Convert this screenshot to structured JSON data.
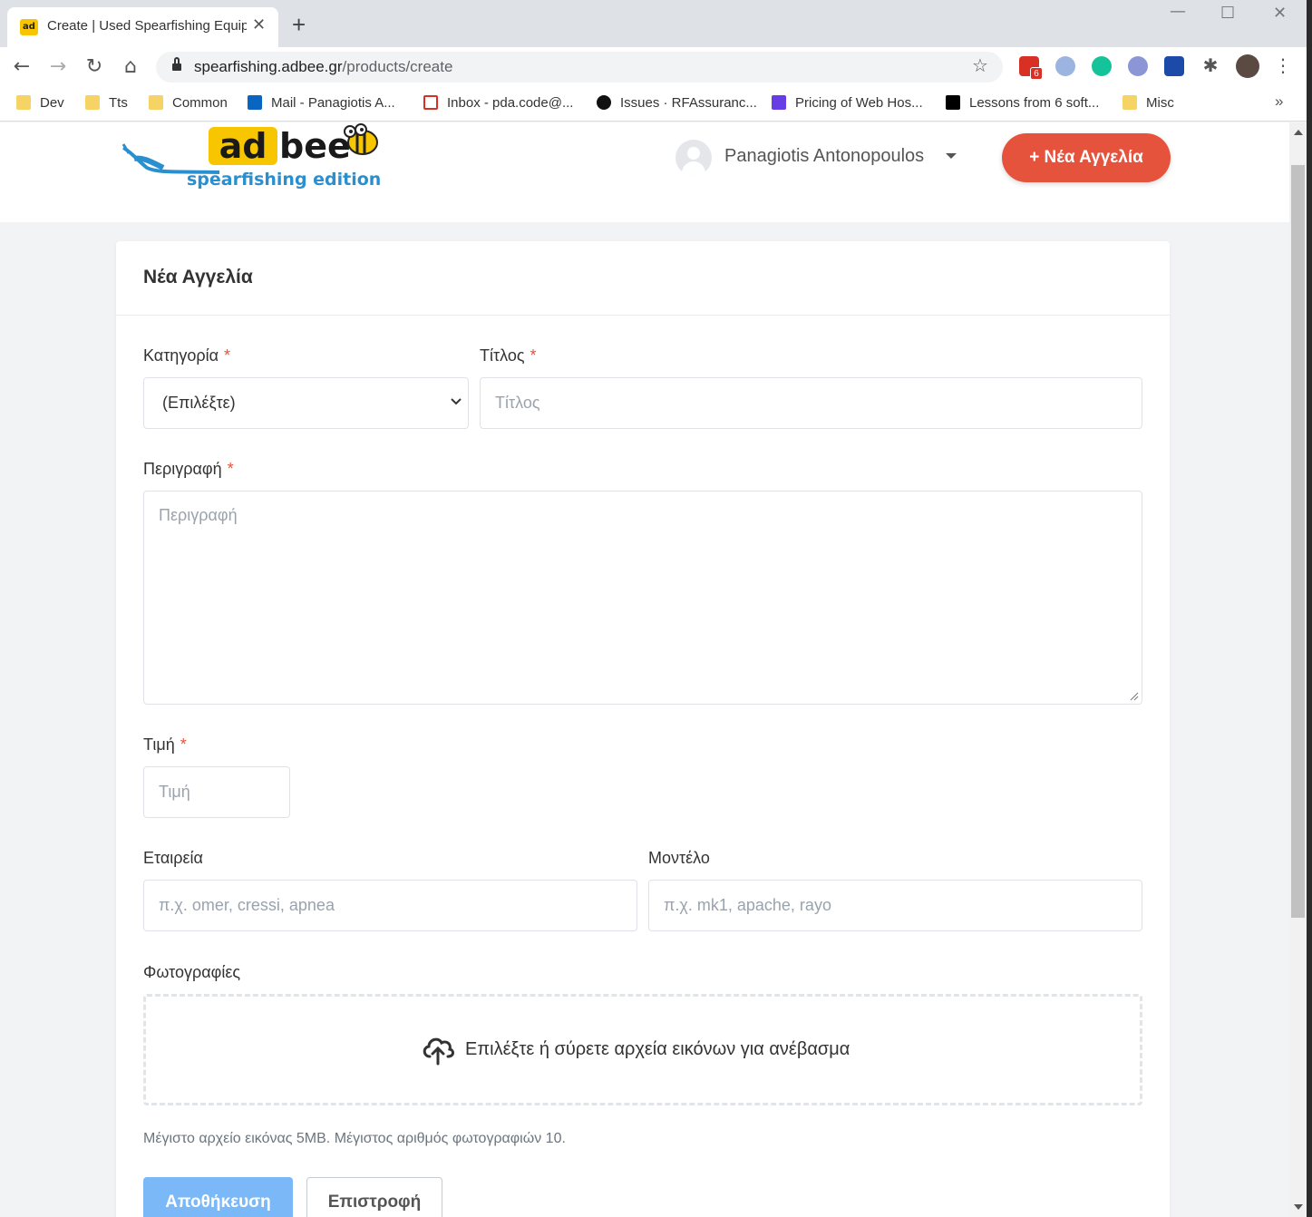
{
  "browser": {
    "tab_title": "Create | Used Spearfishing Equipment",
    "tab_favicon_text": "ad",
    "url_host": "spearfishing.adbee.gr",
    "url_path": "/products/create",
    "gmail_badge": "6",
    "bookmarks": [
      {
        "label": "Dev",
        "icon": "folder-icon"
      },
      {
        "label": "Tts",
        "icon": "folder-icon"
      },
      {
        "label": "Common",
        "icon": "folder-icon"
      },
      {
        "label": "Mail - Panagiotis A...",
        "icon": "outlook-icon"
      },
      {
        "label": "Inbox - pda.code@...",
        "icon": "gmail-icon"
      },
      {
        "label": "Issues · RFAssuranc...",
        "icon": "github-icon"
      },
      {
        "label": "Pricing of Web Hos...",
        "icon": "hostinger-icon"
      },
      {
        "label": "Lessons from 6 soft...",
        "icon": "medium-icon"
      },
      {
        "label": "Misc",
        "icon": "folder-icon"
      }
    ],
    "more_bookmarks": "»"
  },
  "header": {
    "logo_ad": "ad",
    "logo_bee": "bee",
    "logo_subtitle": "spearfishing edition",
    "user_name": "Panagiotis Antonopoulos",
    "new_ad_button": "+ Νέα Αγγελία"
  },
  "form": {
    "card_title": "Νέα Αγγελία",
    "required_mark": "*",
    "category": {
      "label": "Κατηγορία",
      "value": "(Επιλέξτε)"
    },
    "title": {
      "label": "Τίτλος",
      "placeholder": "Τίτλος"
    },
    "description": {
      "label": "Περιγραφή",
      "placeholder": "Περιγραφή"
    },
    "price": {
      "label": "Τιμή",
      "placeholder": "Τιμή"
    },
    "company": {
      "label": "Εταιρεία",
      "placeholder": "π.χ. omer, cressi, apnea"
    },
    "model": {
      "label": "Μοντέλο",
      "placeholder": "π.χ. mk1, apache, rayo"
    },
    "photos": {
      "label": "Φωτογραφίες",
      "dropzone_text": "Επιλέξτε ή σύρετε αρχεία εικόνων για ανέβασμα",
      "help_text": "Μέγιστο αρχείο εικόνας 5MB. Μέγιστος αριθμός φωτογραφιών 10."
    },
    "save_button": "Αποθήκευση",
    "back_button": "Επιστροφή"
  },
  "colors": {
    "brand_yellow": "#f7c600",
    "accent_red": "#e5533d",
    "save_blue": "#7bb8f7",
    "logo_blue": "#2a8fcf"
  }
}
